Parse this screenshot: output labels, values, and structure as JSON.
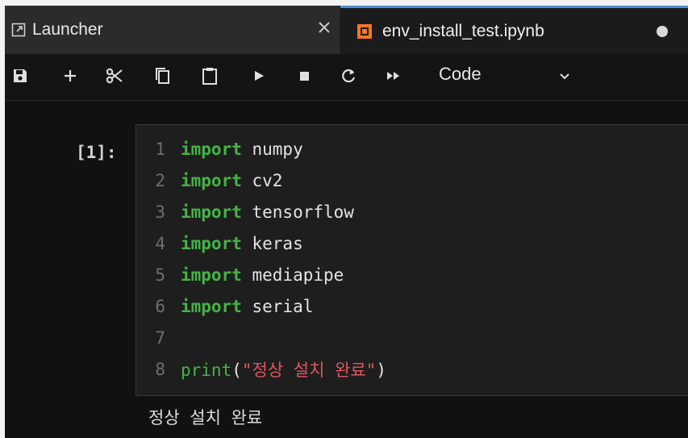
{
  "tabs": {
    "launcher": {
      "label": "Launcher",
      "icon": "launcher-icon"
    },
    "notebook": {
      "label": "env_install_test.ipynb",
      "icon": "notebook-icon",
      "unsaved_indicator": "dot"
    }
  },
  "toolbar": {
    "icons": [
      "save-icon",
      "add-cell-icon",
      "cut-icon",
      "copy-icon",
      "paste-icon",
      "run-icon",
      "stop-icon",
      "restart-icon",
      "fast-forward-icon"
    ],
    "cell_type": "Code"
  },
  "cell": {
    "prompt": "[1]:",
    "lines": [
      {
        "num": "1",
        "kw": "import",
        "rest": " numpy"
      },
      {
        "num": "2",
        "kw": "import",
        "rest": " cv2"
      },
      {
        "num": "3",
        "kw": "import",
        "rest": " tensorflow"
      },
      {
        "num": "4",
        "kw": "import",
        "rest": " keras"
      },
      {
        "num": "5",
        "kw": "import",
        "rest": " mediapipe"
      },
      {
        "num": "6",
        "kw": "import",
        "rest": " serial"
      },
      {
        "num": "7",
        "kw": "",
        "rest": ""
      },
      {
        "num": "8",
        "fn": "print",
        "open": "(",
        "str": "\"정상 설치 완료\"",
        "close": ")"
      }
    ],
    "output": "정상 설치 완료"
  },
  "colors": {
    "accent": "#4c8fd6",
    "keyword": "#44b544",
    "string": "#e05561"
  }
}
